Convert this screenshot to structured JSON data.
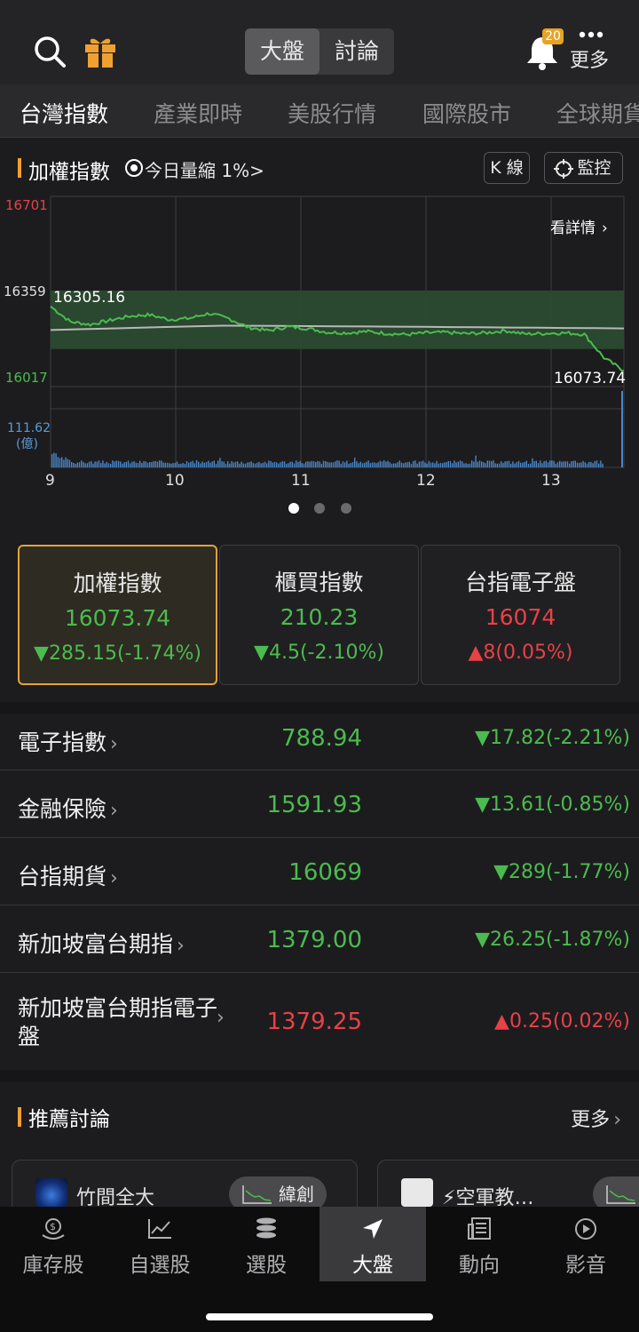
{
  "header": {
    "segments": [
      "大盤",
      "討論"
    ],
    "active_segment": 0,
    "notification_count": "20",
    "more_label": "更多"
  },
  "tabs": [
    "台灣指數",
    "產業即時",
    "美股行情",
    "國際股市",
    "全球期貨"
  ],
  "chart": {
    "title": "加權指數",
    "volume_note": "今日量縮 1%>",
    "kline_label": "K 線",
    "monitor_label": "監控",
    "detail_label": "看詳情",
    "y_top": "16701",
    "y_mid": "16359",
    "y_bottom": "16017",
    "open_label": "16305.16",
    "last_label": "16073.74",
    "vol_label": "111.62",
    "vol_unit": "(億)",
    "x_labels": [
      "9",
      "10",
      "11",
      "12",
      "13"
    ],
    "colors": {
      "up": "#e84148",
      "down": "#4cbb4f",
      "accent": "#f0a030"
    }
  },
  "chart_data": {
    "type": "line",
    "title": "加權指數",
    "x": [
      "9",
      "10",
      "11",
      "12",
      "13"
    ],
    "ylim": [
      16017,
      16701
    ],
    "series": [
      {
        "values": [
          16305.16,
          16250,
          16240,
          16255,
          16270,
          16275,
          16258,
          16262,
          16280,
          16262,
          16230,
          16218,
          16232,
          16226,
          16212,
          16210,
          16215,
          16208,
          16204,
          16210,
          16212,
          16207,
          16210,
          16218,
          16206,
          16208,
          16210,
          16205,
          16120,
          16073.74
        ]
      }
    ],
    "volume": {
      "peak": 111.62,
      "unit": "億"
    }
  },
  "pager": {
    "count": 3,
    "active": 0
  },
  "cards": [
    {
      "name": "加權指數",
      "value": "16073.74",
      "change": "▼285.15(-1.74%)",
      "dir": "down"
    },
    {
      "name": "櫃買指數",
      "value": "210.23",
      "change": "▼4.5(-2.10%)",
      "dir": "down"
    },
    {
      "name": "台指電子盤",
      "value": "16074",
      "change": "▲8(0.05%)",
      "dir": "up"
    }
  ],
  "rows": [
    {
      "name": "電子指數",
      "value": "788.94",
      "change": "▼17.82(-2.21%)",
      "dir": "down"
    },
    {
      "name": "金融保險",
      "value": "1591.93",
      "change": "▼13.61(-0.85%)",
      "dir": "down"
    },
    {
      "name": "台指期貨",
      "value": "16069",
      "change": "▼289(-1.77%)",
      "dir": "down"
    },
    {
      "name": "新加坡富台期指",
      "value": "1379.00",
      "change": "▼26.25(-1.87%)",
      "dir": "down"
    },
    {
      "name": "新加坡富台期指電子盤",
      "value": "1379.25",
      "change": "▲0.25(0.02%)",
      "dir": "up"
    }
  ],
  "recommend": {
    "title": "推薦討論",
    "more": "更多",
    "posts": [
      {
        "author": "竹間全大",
        "stock": "緯創"
      },
      {
        "author": "⚡空軍教…",
        "stock": ""
      }
    ]
  },
  "bottom_nav": [
    {
      "label": "庫存股",
      "icon": "moneybag-icon"
    },
    {
      "label": "自選股",
      "icon": "trend-icon"
    },
    {
      "label": "選股",
      "icon": "coins-icon"
    },
    {
      "label": "大盤",
      "icon": "navigation-arrow-icon",
      "active": true
    },
    {
      "label": "動向",
      "icon": "news-icon"
    },
    {
      "label": "影音",
      "icon": "play-icon"
    }
  ]
}
